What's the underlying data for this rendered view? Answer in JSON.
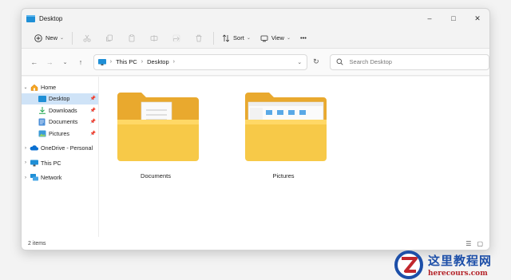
{
  "window": {
    "title": "Desktop",
    "controls": {
      "minimize": "–",
      "maximize": "□",
      "close": "✕"
    }
  },
  "toolbar": {
    "new_label": "New",
    "sort_label": "Sort",
    "view_label": "View",
    "more_label": "•••",
    "icons": [
      "scissors-icon",
      "copy-icon",
      "paste-icon",
      "rename-icon",
      "share-icon",
      "delete-icon"
    ]
  },
  "address": {
    "crumbs": [
      "This PC",
      "Desktop"
    ],
    "search_placeholder": "Search Desktop"
  },
  "nav": {
    "home": "Home",
    "quick_access": [
      {
        "label": "Desktop",
        "icon": "desktop-icon",
        "pinned": true,
        "selected": true
      },
      {
        "label": "Downloads",
        "icon": "download-icon",
        "pinned": true
      },
      {
        "label": "Documents",
        "icon": "documents-icon",
        "pinned": true
      },
      {
        "label": "Pictures",
        "icon": "pictures-icon",
        "pinned": true
      }
    ],
    "onedrive": "OneDrive - Personal",
    "thispc": "This PC",
    "network": "Network"
  },
  "main": {
    "folders": [
      {
        "label": "Documents",
        "preview": "document-page"
      },
      {
        "label": "Pictures",
        "preview": "explorer-screenshot"
      }
    ]
  },
  "status": {
    "item_count": "2 items"
  },
  "watermark": {
    "cn": "这里教程网",
    "en": "herecours.com"
  },
  "colors": {
    "folder": "#f5c342",
    "folder_back": "#e9a92e",
    "accent": "#0067c0",
    "selected": "#cfe3f7"
  }
}
